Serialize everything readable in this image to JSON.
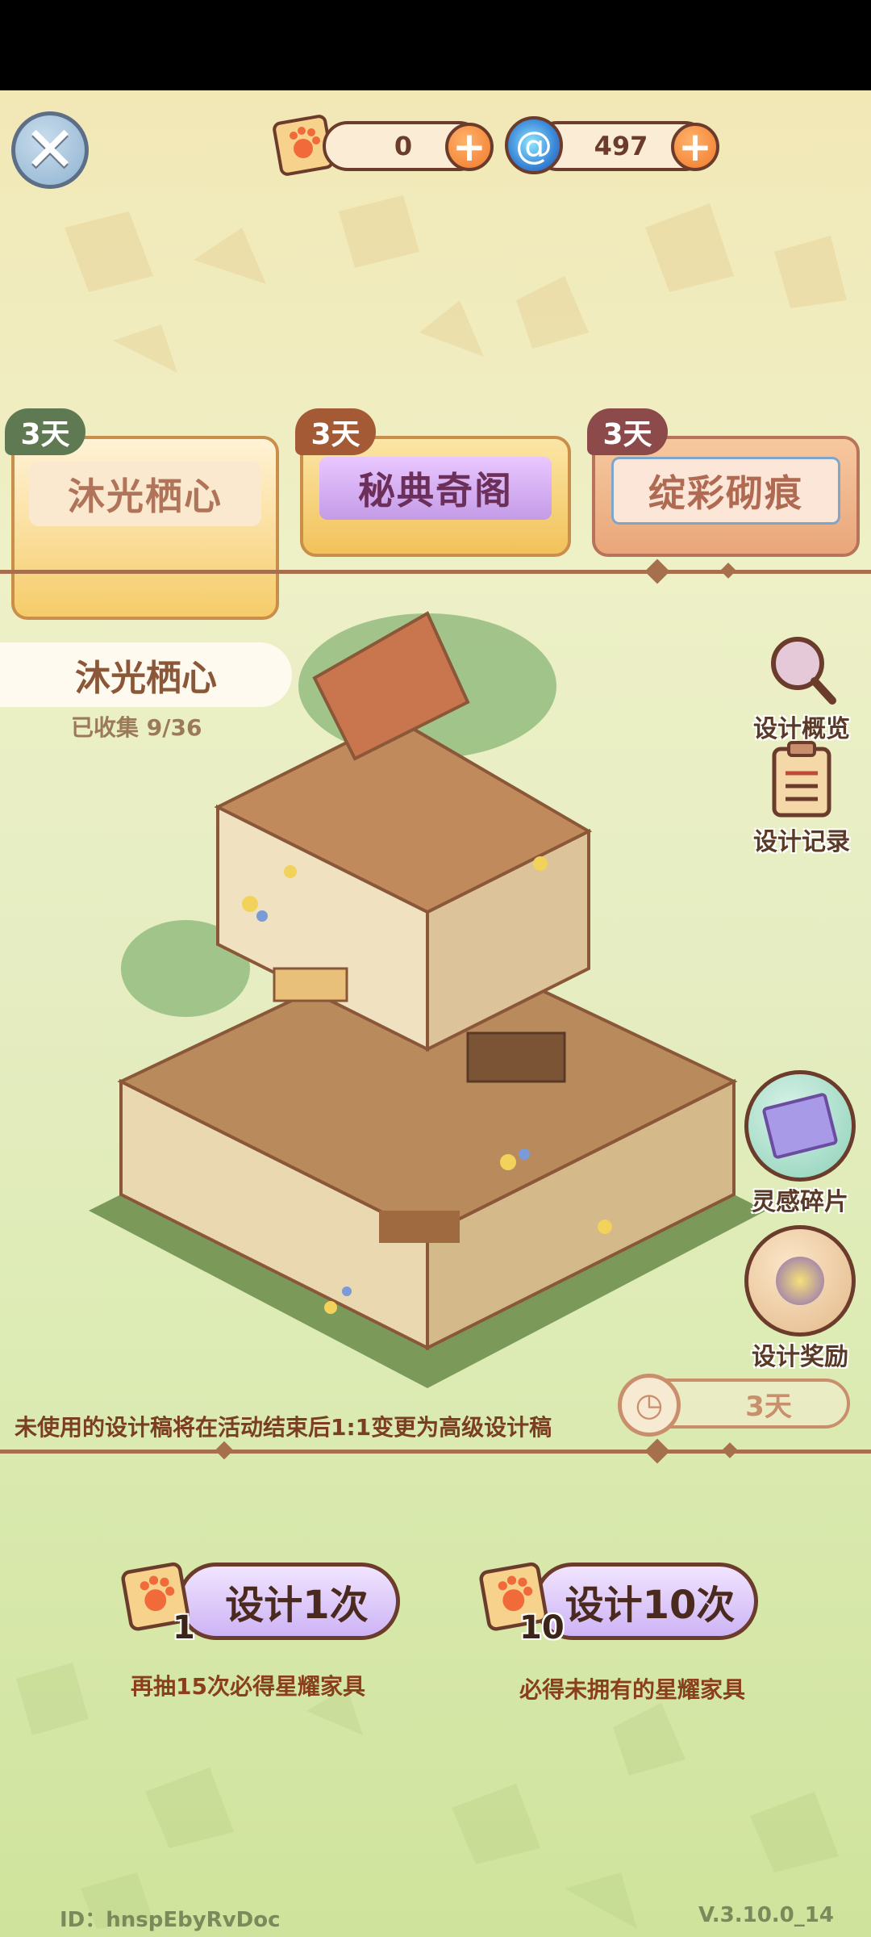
{
  "header": {
    "close_icon": "close-icon",
    "paw_scroll_count": "0",
    "swirl_count": "497",
    "plus_label": "+"
  },
  "tabs": [
    {
      "label": "沐光栖心",
      "badge": "3天",
      "active": true
    },
    {
      "label": "秘典奇阁",
      "badge": "3天",
      "active": false
    },
    {
      "label": "绽彩砌痕",
      "badge": "3天",
      "active": false
    }
  ],
  "main": {
    "set_name": "沐光栖心",
    "collected": "已收集 9/36",
    "notice": "未使用的设计稿将在活动结束后1:1变更为高级设计稿",
    "timer": "3天"
  },
  "side": {
    "overview": "设计概览",
    "records": "设计记录",
    "fragments": "灵感碎片",
    "rewards": "设计奖励"
  },
  "draw": {
    "single_label": "设计1次",
    "single_count": "1",
    "single_note": "再抽15次必得星耀家具",
    "ten_label": "设计10次",
    "ten_count": "10",
    "ten_note": "必得未拥有的星耀家具"
  },
  "footer": {
    "id": "ID：hnspEbyRvDoc",
    "version": "V.3.10.0_14"
  },
  "colors": {
    "brown": "#6b3c2b",
    "badge_green": "#5f7a52",
    "badge_brown": "#a35a35",
    "badge_rose": "#8c4a4a",
    "button_purple": "#cdb4f5"
  }
}
